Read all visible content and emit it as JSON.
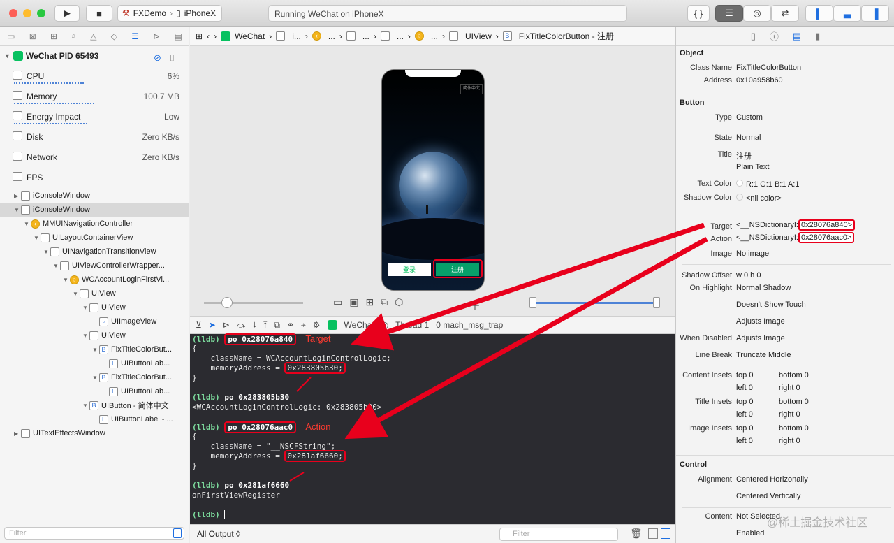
{
  "toolbar": {
    "scheme_app": "FXDemo",
    "scheme_device": "iPhoneX",
    "activity": "Running WeChat on iPhoneX"
  },
  "nav": {
    "process": "WeChat PID 65493",
    "gauges": [
      {
        "name": "CPU",
        "value": "6%"
      },
      {
        "name": "Memory",
        "value": "100.7 MB"
      },
      {
        "name": "Energy Impact",
        "value": "Low"
      },
      {
        "name": "Disk",
        "value": "Zero KB/s"
      },
      {
        "name": "Network",
        "value": "Zero KB/s"
      },
      {
        "name": "FPS",
        "value": ""
      }
    ],
    "tree": [
      "iConsoleWindow",
      "iConsoleWindow",
      "MMUINavigationController",
      "UILayoutContainerView",
      "UINavigationTransitionView",
      "UIViewControllerWrapper...",
      "WCAccountLoginFirstVi...",
      "UIView",
      "UIView",
      "UIImageView",
      "UIView",
      "FixTitleColorBut...",
      "UIButtonLab...",
      "FixTitleColorBut...",
      "UIButtonLab...",
      "UIButton - 简体中文",
      "UIButtonLabel - ...",
      "UITextEffectsWindow"
    ],
    "filter_placeholder": "Filter"
  },
  "jump": {
    "items": [
      "WeChat",
      "i...",
      "...",
      "...",
      "...",
      "...",
      "UIView",
      "FixTitleColorButton - 注册"
    ]
  },
  "phone": {
    "lang": "简体中文",
    "login": "登录",
    "register": "注册"
  },
  "debugbar": {
    "app": "WeChat",
    "thread": "Thread 1",
    "frame": "0 mach_msg_trap"
  },
  "console": {
    "l1": "po 0x28076a840",
    "n1": "Target",
    "l2": "{",
    "l3": "    className = WCAccountLoginControlLogic;",
    "l4a": "    memoryAddress = ",
    "l4b": "0x283805b30;",
    "l5": "}",
    "l6": "po 0x283805b30",
    "l7": "<WCAccountLoginControlLogic: 0x283805b30>",
    "l8": "po 0x28076aac0",
    "n2": "Action",
    "l9": "{",
    "l10": "    className = \"__NSCFString\";",
    "l11a": "    memoryAddress = ",
    "l11b": "0x281af6660;",
    "l12": "}",
    "l13": "po 0x281af6660",
    "l14": "onFirstViewRegister",
    "prompt": "(lldb)"
  },
  "bottom": {
    "output": "All Output ◊",
    "filter_placeholder": "Filter"
  },
  "inspector": {
    "object_title": "Object",
    "class_name": "FixTitleColorButton",
    "address": "0x10a958b60",
    "button_title": "Button",
    "type": "Custom",
    "state": "Normal",
    "title": "注册",
    "title2": "Plain Text",
    "text_color": "R:1 G:1 B:1 A:1",
    "shadow_color": "<nil color>",
    "target_prefix": "<__NSDictionaryI:",
    "target_addr": "0x28076a840>",
    "action_prefix": "<__NSDictionaryI:",
    "action_addr": "0x28076aac0>",
    "image": "No image",
    "shadow_offset": "w 0    h 0",
    "on_highlight": "Normal Shadow",
    "show_touch": "Doesn't Show Touch",
    "adjusts1": "Adjusts Image",
    "when_disabled": "Adjusts Image",
    "line_break": "Truncate Middle",
    "insets_top": "top 0",
    "insets_bottom": "bottom 0",
    "insets_left": "left 0",
    "insets_right": "right 0",
    "control_title": "Control",
    "alignment_h": "Centered Horizonally",
    "alignment_v": "Centered Vertically",
    "content1": "Not Selected",
    "content2": "Enabled"
  },
  "labels": {
    "class_name": "Class Name",
    "address": "Address",
    "type": "Type",
    "state": "State",
    "title": "Title",
    "text_color": "Text Color",
    "shadow_color": "Shadow Color",
    "target": "Target",
    "action": "Action",
    "image": "Image",
    "shadow_offset": "Shadow Offset",
    "on_highlight": "On Highlight",
    "when_disabled": "When Disabled",
    "line_break": "Line Break",
    "content_insets": "Content Insets",
    "title_insets": "Title Insets",
    "image_insets": "Image Insets",
    "alignment": "Alignment",
    "content": "Content"
  },
  "watermark": "@稀土掘金技术社区",
  "colors": {
    "accent": "#1f6fe0",
    "annotation": "#e8001c",
    "console_bg": "#2b2b30",
    "wechat_green": "#07c160"
  }
}
